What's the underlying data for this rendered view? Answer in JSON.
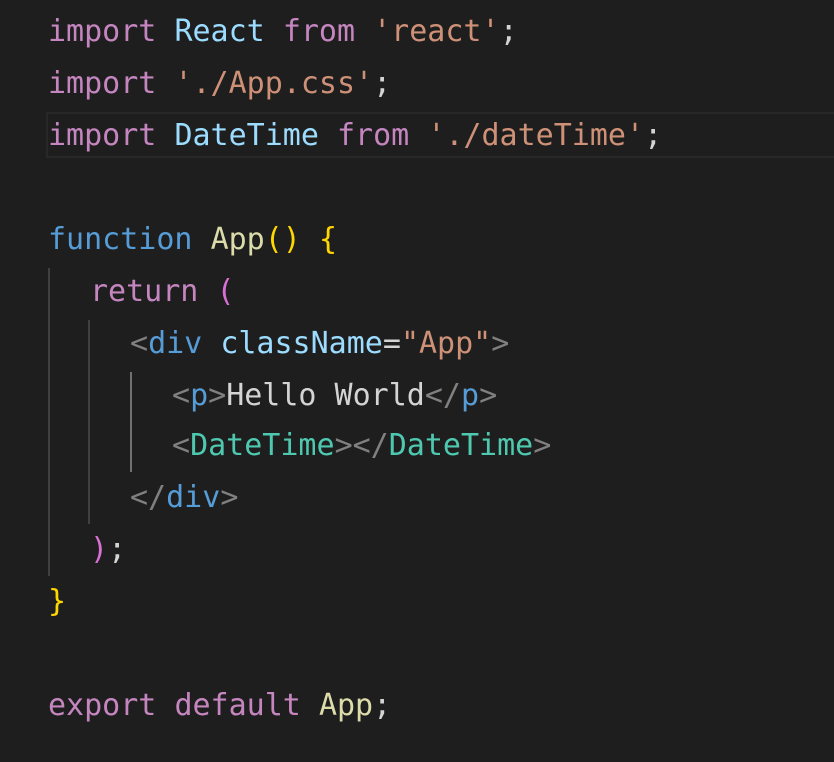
{
  "lines": {
    "l1": {
      "import": "import",
      "name": "React",
      "from": "from",
      "str": "'react'",
      "semi": ";"
    },
    "l2": {
      "import": "import",
      "str": "'./App.css'",
      "semi": ";"
    },
    "l3": {
      "import": "import",
      "name": "DateTime",
      "from": "from",
      "str": "'./dateTime'",
      "semi": ";"
    },
    "l5": {
      "function": "function",
      "name": "App",
      "parens": "()",
      "brace": "{"
    },
    "l6": {
      "return": "return",
      "paren": "("
    },
    "l7": {
      "open": "<",
      "tag": "div",
      "attr": "className",
      "eq": "=",
      "str": "\"App\"",
      "close": ">"
    },
    "l8": {
      "open": "<",
      "tag": "p",
      "close": ">",
      "text": "Hello World",
      "endopen": "</",
      "endtag": "p",
      "endclose": ">"
    },
    "l9": {
      "open": "<",
      "tag": "DateTime",
      "mid": "></",
      "endtag": "DateTime",
      "close": ">"
    },
    "l10": {
      "open": "</",
      "tag": "div",
      "close": ">"
    },
    "l11": {
      "paren": ")",
      "semi": ";"
    },
    "l12": {
      "brace": "}"
    },
    "l14": {
      "export": "export",
      "default": "default",
      "name": "App",
      "semi": ";"
    }
  }
}
